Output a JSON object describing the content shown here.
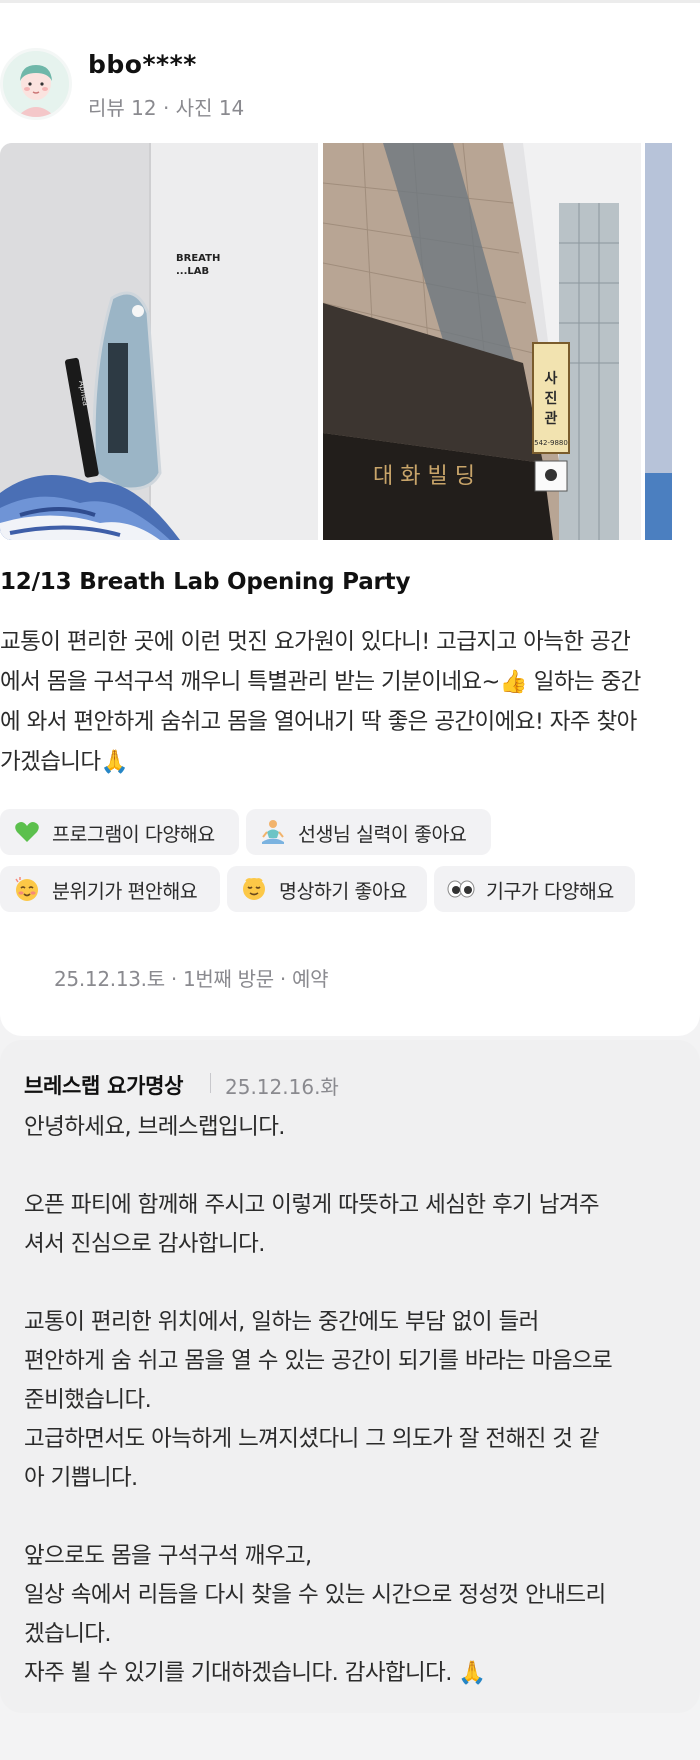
{
  "review": {
    "username": "bbo****",
    "meta": "리뷰 12 · 사진 14",
    "photos": [
      {
        "icon": "yoga-studio-mirror-photo",
        "sign": "BREATH\n...LAB",
        "mat_label": "Apnea"
      },
      {
        "icon": "building-exterior-photo",
        "sign": "사진관",
        "phone": "542-9880"
      },
      {
        "icon": "partial-photo"
      }
    ],
    "title": "12/13 Breath Lab Opening Party",
    "body_lines": [
      "교통이 편리한 곳에 이런 멋진 요가원이 있다니! 고급지고 아늑한 공간",
      "에서 몸을 구석구석 깨우니 특별관리 받는 기분이네요~👍 일하는 중간",
      "에 와서 편안하게 숨쉬고 몸을 열어내기 딱 좋은 공간이에요! 자주 찾아",
      "가겠습니다🙏"
    ],
    "tags": [
      {
        "icon": "green-heart-icon",
        "label": "프로그램이 다양해요"
      },
      {
        "icon": "meditation-person-icon",
        "label": "선생님 실력이 좋아요"
      },
      {
        "icon": "blushing-face-icon",
        "label": "분위기가 편안해요"
      },
      {
        "icon": "relieved-face-icon",
        "label": "명상하기 좋아요"
      },
      {
        "icon": "eyes-icon",
        "label": "기구가 다양해요"
      }
    ],
    "visit_info": "25.12.13.토 · 1번째 방문 · 예약"
  },
  "reply": {
    "owner": "브레스랩 요가명상",
    "date": "25.12.16.화",
    "lines": [
      "안녕하세요, 브레스랩입니다.",
      "",
      "오픈 파티에 함께해 주시고 이렇게 따뜻하고 세심한 후기 남겨주",
      "셔서 진심으로 감사합니다.",
      "",
      "교통이 편리한 위치에서, 일하는 중간에도 부담 없이 들러",
      "편안하게 숨 쉬고 몸을 열 수 있는 공간이 되기를 바라는 마음으로",
      "준비했습니다.",
      "고급하면서도 아늑하게 느껴지셨다니 그 의도가 잘 전해진 것 같",
      "아 기쁩니다.",
      "",
      "앞으로도 몸을 구석구석 깨우고,",
      "일상 속에서 리듬을 다시 찾을 수 있는 시간으로 정성껏 안내드리",
      "겠습니다.",
      "자주 뵐 수 있기를 기대하겠습니다. 감사합니다. 🙏"
    ]
  },
  "colors": {
    "card_bg": "#ffffff",
    "page_bg": "#f3f3f4",
    "reply_bg": "#f0f0f1",
    "tag_bg": "#f2f2f4",
    "muted_text": "#8a8a8f"
  }
}
